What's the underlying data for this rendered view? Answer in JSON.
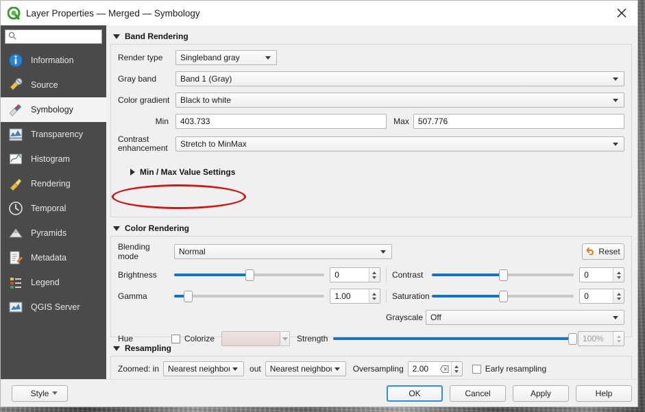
{
  "window": {
    "title": "Layer Properties — Merged — Symbology",
    "logo_icon": "qgis-logo-icon",
    "close_icon": "close-icon"
  },
  "sidebar": {
    "search": {
      "value": "",
      "placeholder": "",
      "icon": "search-icon"
    },
    "items": [
      {
        "label": "Information",
        "icon": "information-icon",
        "selected": false
      },
      {
        "label": "Source",
        "icon": "source-icon",
        "selected": false
      },
      {
        "label": "Symbology",
        "icon": "symbology-icon",
        "selected": true
      },
      {
        "label": "Transparency",
        "icon": "transparency-icon",
        "selected": false
      },
      {
        "label": "Histogram",
        "icon": "histogram-icon",
        "selected": false
      },
      {
        "label": "Rendering",
        "icon": "rendering-icon",
        "selected": false
      },
      {
        "label": "Temporal",
        "icon": "temporal-icon",
        "selected": false
      },
      {
        "label": "Pyramids",
        "icon": "pyramids-icon",
        "selected": false
      },
      {
        "label": "Metadata",
        "icon": "metadata-icon",
        "selected": false
      },
      {
        "label": "Legend",
        "icon": "legend-icon",
        "selected": false
      },
      {
        "label": "QGIS Server",
        "icon": "qgis-server-icon",
        "selected": false
      }
    ]
  },
  "band_rendering": {
    "section_title": "Band Rendering",
    "expanded": true,
    "render_type": {
      "label": "Render type",
      "value": "Singleband gray"
    },
    "gray_band": {
      "label": "Gray band",
      "value": "Band 1 (Gray)"
    },
    "color_gradient": {
      "label": "Color gradient",
      "value": "Black to white"
    },
    "min": {
      "label": "Min",
      "value": "403.733"
    },
    "max": {
      "label": "Max",
      "value": "507.776"
    },
    "contrast_enhancement": {
      "label": "Contrast\nenhancement",
      "label_line1": "Contrast",
      "label_line2": "enhancement",
      "value": "Stretch to MinMax"
    },
    "min_max_value_settings": {
      "title": "Min / Max Value Settings",
      "expanded": false,
      "annotated": true,
      "annotation_color": "#d01818"
    }
  },
  "color_rendering": {
    "section_title": "Color Rendering",
    "expanded": true,
    "blending_mode": {
      "label": "Blending mode",
      "value": "Normal"
    },
    "reset_button": {
      "label": "Reset",
      "icon": "undo-icon",
      "icon_color": "#e07820"
    },
    "brightness": {
      "label": "Brightness",
      "value": "0",
      "slider_percent": 50
    },
    "contrast": {
      "label": "Contrast",
      "value": "0",
      "slider_percent": 50
    },
    "gamma": {
      "label": "Gamma",
      "value": "1.00",
      "slider_percent": 9
    },
    "saturation": {
      "label": "Saturation",
      "value": "0",
      "slider_percent": 50
    },
    "grayscale": {
      "label": "Grayscale",
      "value": "Off"
    },
    "hue": {
      "label": "Hue",
      "colorize": {
        "label": "Colorize",
        "checked": false
      },
      "color_swatch": "#e9dcda",
      "strength": {
        "label": "Strength",
        "value": "100%",
        "slider_percent": 100,
        "enabled": false
      }
    }
  },
  "resampling": {
    "section_title": "Resampling",
    "expanded": true,
    "zoomed_in": {
      "label": "Zoomed: in",
      "value": "Nearest neighbour"
    },
    "zoomed_out": {
      "label": "out",
      "value": "Nearest neighbour"
    },
    "oversampling": {
      "label": "Oversampling",
      "value": "2.00",
      "clear_icon": "clear-icon"
    },
    "early_resampling": {
      "label": "Early resampling",
      "checked": false
    }
  },
  "footer": {
    "style_button": "Style",
    "ok_button": "OK",
    "cancel_button": "Cancel",
    "apply_button": "Apply",
    "help_button": "Help"
  }
}
